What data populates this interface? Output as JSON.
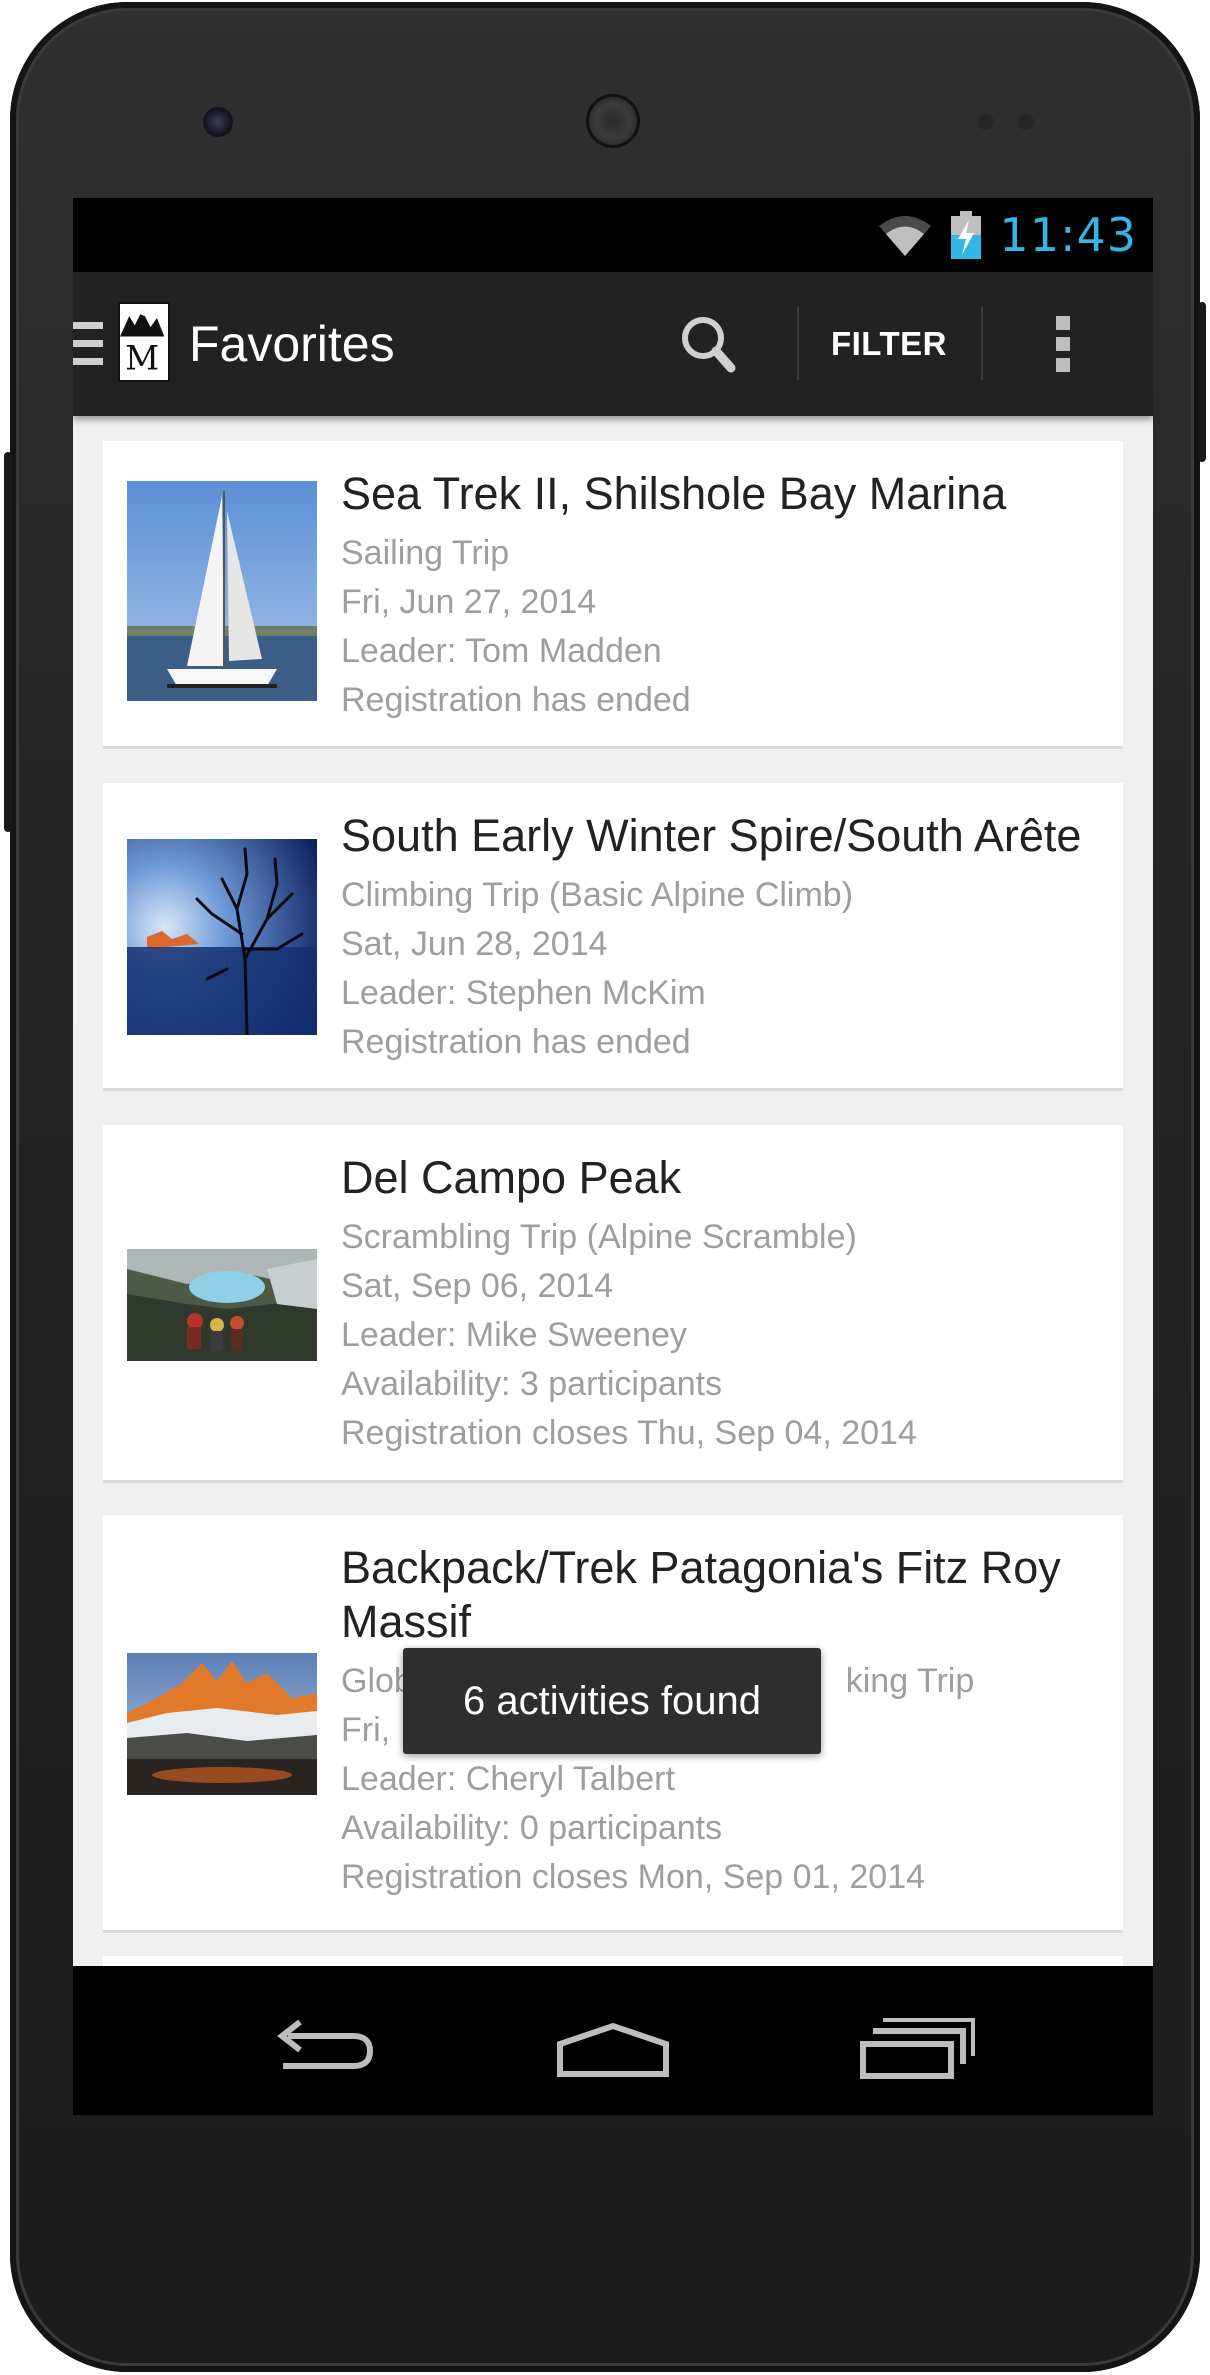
{
  "status_bar": {
    "time": "11:43",
    "wifi_icon": "wifi-icon",
    "battery_icon": "battery-charging-icon",
    "time_color": "#33b5e5"
  },
  "action_bar": {
    "title": "Favorites",
    "filter_label": "FILTER",
    "search_icon": "search-icon",
    "overflow_icon": "overflow-menu-icon",
    "drawer_icon": "drawer-menu-icon",
    "logo_icon": "mountaineers-logo",
    "logo_letter": "M"
  },
  "activities": [
    {
      "title": "Sea Trek II, Shilshole Bay Marina",
      "type": "Sailing Trip",
      "date": "Fri, Jun 27, 2014",
      "leader": "Leader: Tom Madden",
      "registration": "Registration has ended",
      "image": "sailboat-photo"
    },
    {
      "title": "South Early Winter Spire/South Arête",
      "type": "Climbing Trip (Basic Alpine Climb)",
      "date": "Sat, Jun 28, 2014",
      "leader": "Leader: Stephen McKim",
      "registration": "Registration has ended",
      "image": "tree-silhouette-photo"
    },
    {
      "title": "Del Campo Peak",
      "type": "Scrambling Trip (Alpine Scramble)",
      "date": "Sat, Sep 06, 2014",
      "leader": "Leader: Mike Sweeney",
      "availability": "Availability: 3 participants",
      "registration": "Registration closes Thu, Sep 04, 2014",
      "image": "hikers-lake-photo"
    },
    {
      "title": "Backpack/Trek Patagonia's Fitz Roy Massif",
      "type_visible_start": "Globa",
      "type_visible_end": "king Trip",
      "date_visible_start": "Fri,",
      "leader": "Leader: Cheryl Talbert",
      "availability": "Availability: 0 participants",
      "registration": "Registration closes Mon, Sep 01, 2014",
      "image": "fitz-roy-sunrise-photo"
    }
  ],
  "toast": {
    "message": "6 activities found"
  },
  "nav_bar": {
    "back_icon": "back-icon",
    "home_icon": "home-icon",
    "recents_icon": "recent-apps-icon"
  }
}
